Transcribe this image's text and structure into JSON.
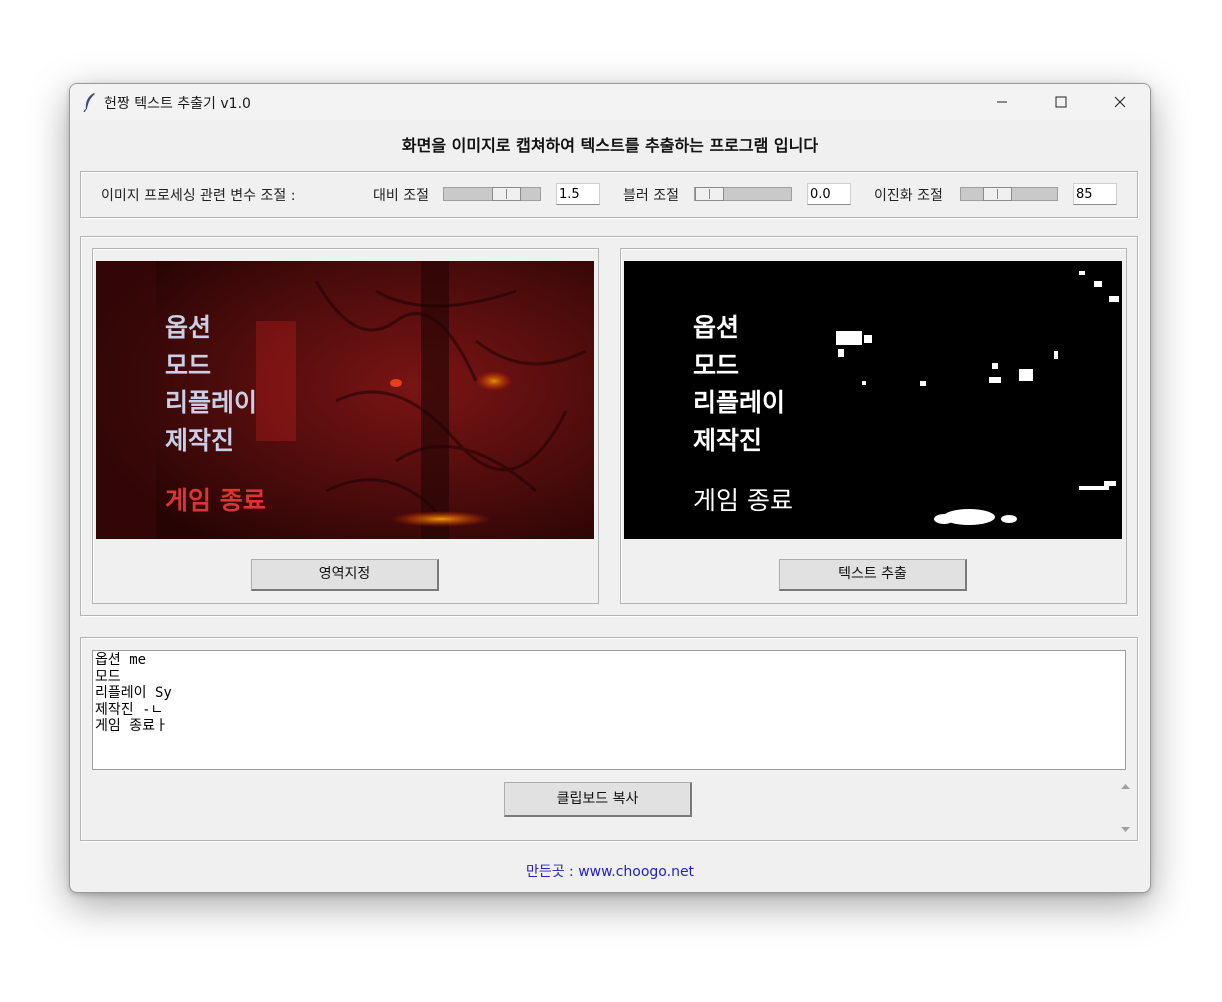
{
  "window": {
    "title": "헌짱 텍스트 추출기 v1.0"
  },
  "headline": "화면을 이미지로 캡쳐하여 텍스트를 추출하는 프로그램 입니다",
  "params": {
    "label": "이미지 프로세싱 관련 변수 조절 :",
    "contrast": {
      "label": "대비 조절",
      "value": "1.5",
      "level": 0.72
    },
    "blur": {
      "label": "블러 조절",
      "value": "0.0",
      "level": 0.0
    },
    "threshold": {
      "label": "이진화 조절",
      "value": "85",
      "level": 0.33
    }
  },
  "preview": {
    "original_menu": [
      "옵션",
      "모드",
      "리플레이",
      "제작진"
    ],
    "original_exit": "게임 종료",
    "select_button": "영역지정",
    "extract_button": "텍스트 추출"
  },
  "output": {
    "lines": [
      "옵션 me",
      "모드",
      "리플레이 Sy",
      "제작진 -ㄴ",
      "게임 종료ㅏ"
    ],
    "copy_button": "클립보드 복사"
  },
  "footer": "만든곳 : www.choogo.net",
  "colors": {
    "accent_link": "#2121cc",
    "exit_text_original": "#d93535",
    "menu_text_original": "#c9cfe6"
  }
}
